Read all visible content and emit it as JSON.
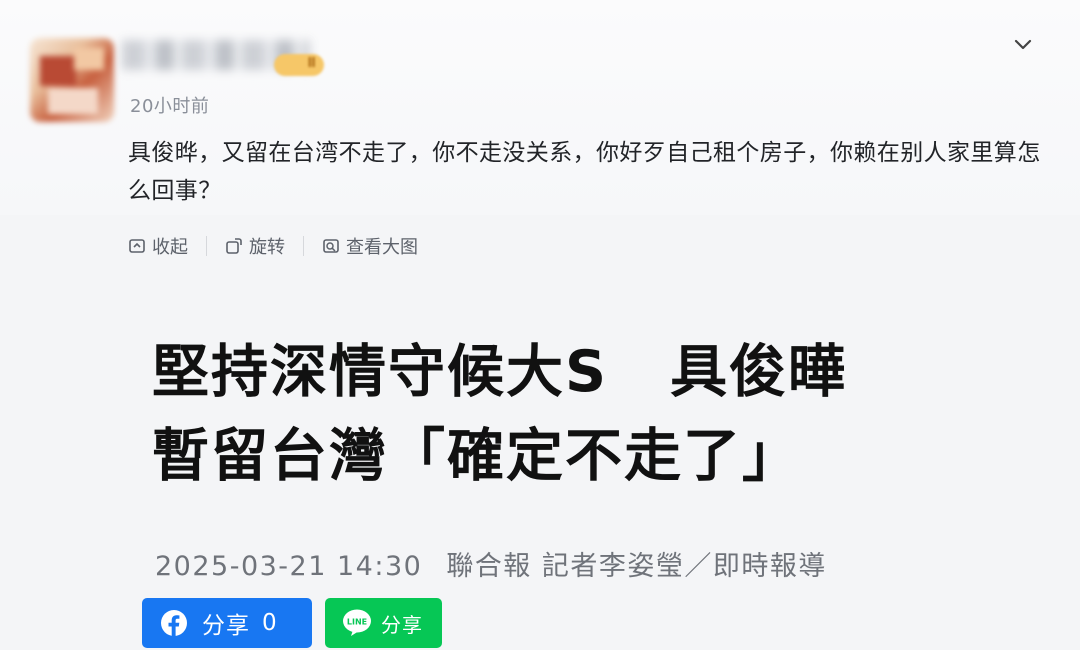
{
  "comment": {
    "time": "20小时前",
    "badge": "Ⅱ",
    "text": "具俊晔，又留在台湾不走了，你不走没关系，你好歹自己租个房子，你赖在别人家里算怎么回事？",
    "actions": {
      "collapse": "收起",
      "rotate": "旋转",
      "view_large": "查看大图"
    }
  },
  "article": {
    "headline_part1": "堅持深情守候大S",
    "headline_part2": "具俊曄",
    "headline_line2": "暫留台灣「確定不走了」",
    "datetime": "2025-03-21 14:30",
    "source": "聯合報 記者李姿瑩／即時報導"
  },
  "share": {
    "facebook_label": "分享",
    "facebook_count": "0",
    "line_label": "分享",
    "facebook_color": "#1877f2",
    "line_color": "#06c755"
  }
}
